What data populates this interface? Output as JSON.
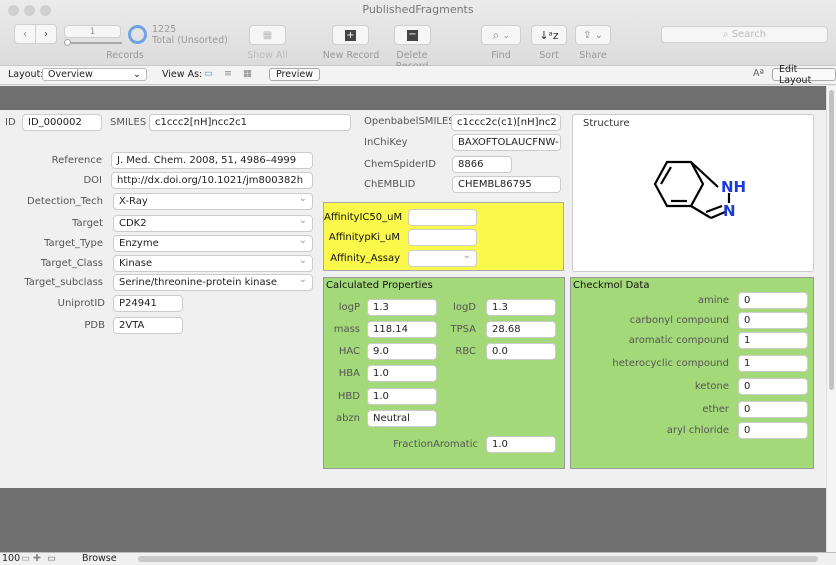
{
  "window": {
    "title": "PublishedFragments"
  },
  "toolbar": {
    "record_current": "1",
    "record_total": "1225",
    "record_status": "Total (Unsorted)",
    "records_label": "Records",
    "show_all": "Show All",
    "new_record": "New Record",
    "delete_record": "Delete Record",
    "find": "Find",
    "sort": "Sort",
    "share": "Share",
    "search_placeholder": "Search"
  },
  "layoutbar": {
    "layout_label": "Layout:",
    "layout_value": "Overview",
    "view_as_label": "View As:",
    "preview": "Preview",
    "edit_layout": "Edit Layout"
  },
  "record": {
    "id_label": "ID",
    "id": "ID_000002",
    "smiles_label": "SMILES",
    "smiles": "c1ccc2[nH]ncc2c1",
    "reference_label": "Reference",
    "reference": "J. Med. Chem. 2008, 51, 4986–4999",
    "doi_label": "DOI",
    "doi": "http://dx.doi.org/10.1021/jm800382h",
    "detection_label": "Detection_Tech",
    "detection": "X-Ray",
    "target_label": "Target",
    "target": "CDK2",
    "target_type_label": "Target_Type",
    "target_type": "Enzyme",
    "target_class_label": "Target_Class",
    "target_class": "Kinase",
    "target_subclass_label": "Target_subclass",
    "target_subclass": "Serine/threonine-protein kinase",
    "uniprot_label": "UniprotID",
    "uniprot": "P24941",
    "pdb_label": "PDB",
    "pdb": "2VTA",
    "openbabel_label": "OpenbabelSMILES",
    "openbabel": "c1ccc2c(c1)[nH]nc2",
    "inchikey_label": "InChiKey",
    "inchikey": "BAXOFTOLAUCFNW-",
    "chemspider_label": "ChemSpiderID",
    "chemspider": "8866",
    "chembl_label": "ChEMBLID",
    "chembl": "CHEMBL86795",
    "structure_label": "Structure",
    "structure_nh": "NH",
    "structure_n": "N"
  },
  "affinity": {
    "ic50_label": "AffinityIC50_uM",
    "ic50": "",
    "pki_label": "AffinitypKi_uM",
    "pki": "",
    "assay_label": "Affinity_Assay",
    "assay": ""
  },
  "calc": {
    "title": "Calculated Properties",
    "logp_label": "logP",
    "logp": "1.3",
    "logd_label": "logD",
    "logd": "1.3",
    "mass_label": "mass",
    "mass": "118.14",
    "tpsa_label": "TPSA",
    "tpsa": "28.68",
    "hac_label": "HAC",
    "hac": "9.0",
    "rbc_label": "RBC",
    "rbc": "0.0",
    "hba_label": "HBA",
    "hba": "1.0",
    "hbd_label": "HBD",
    "hbd": "1.0",
    "abzn_label": "abzn",
    "abzn": "Neutral",
    "fa_label": "FractionAromatic",
    "fa": "1.0"
  },
  "checkmol": {
    "title": "Checkmol Data",
    "items": [
      {
        "label": "amine",
        "value": "0"
      },
      {
        "label": "carbonyl compound",
        "value": "0"
      },
      {
        "label": "aromatic compound",
        "value": "1"
      },
      {
        "label": "heterocyclic compound",
        "value": "1"
      },
      {
        "label": "ketone",
        "value": "0"
      },
      {
        "label": "ether",
        "value": "0"
      },
      {
        "label": "aryl chloride",
        "value": "0"
      }
    ]
  },
  "statusbar": {
    "zoom": "100",
    "mode": "Browse"
  },
  "colors": {
    "yellow_panel": "#fbf84c",
    "green_panel": "#a4d97a",
    "accent": "#3b8de0"
  }
}
